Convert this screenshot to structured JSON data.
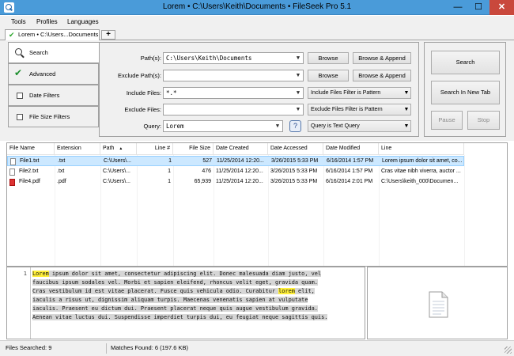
{
  "window": {
    "title": "Lorem • C:\\Users\\Keith\\Documents • FileSeek Pro 5.1",
    "minimize_glyph": "—",
    "maximize_glyph": "☐",
    "close_glyph": "✕"
  },
  "menu": [
    "Tools",
    "Profiles",
    "Languages"
  ],
  "tabs": {
    "active_label": "Lorem • C:\\Users...Documents",
    "add_glyph": "+"
  },
  "sidebar": [
    {
      "label": "Search",
      "icon": "search-icon",
      "active": true
    },
    {
      "label": "Advanced",
      "icon": "checked-checkbox-icon",
      "active": false
    },
    {
      "label": "Date Filters",
      "icon": "checkbox-icon",
      "active": false
    },
    {
      "label": "File Size Filters",
      "icon": "checkbox-icon",
      "active": false
    }
  ],
  "form": {
    "paths_label": "Path(s):",
    "paths_value": "C:\\Users\\Keith\\Documents",
    "exclude_paths_label": "Exclude Path(s):",
    "exclude_paths_value": "",
    "include_files_label": "Include Files:",
    "include_files_value": "*.*",
    "exclude_files_label": "Exclude Files:",
    "exclude_files_value": "",
    "query_label": "Query:",
    "query_value": "Lorem",
    "browse_label": "Browse",
    "browse_append_label": "Browse & Append",
    "include_filter_mode": "Include Files Filter is Pattern",
    "exclude_filter_mode": "Exclude Files Filter is Pattern",
    "query_mode": "Query is Text Query",
    "help_glyph": "?"
  },
  "actions": {
    "search": "Search",
    "search_new_tab": "Search In New Tab",
    "pause": "Pause",
    "stop": "Stop"
  },
  "results": {
    "columns": [
      "File Name",
      "Extension",
      "Path",
      "Line #",
      "File Size",
      "Date Created",
      "Date Accessed",
      "Date Modified",
      "Line"
    ],
    "sort_glyph": "▲",
    "rows": [
      {
        "name": "File1.txt",
        "ext": ".txt",
        "path": "C:\\Users\\...",
        "line": "1",
        "size": "527",
        "created": "11/25/2014 12:20...",
        "accessed": "3/26/2015 5:33 PM",
        "modified": "6/16/2014 1:57 PM",
        "text": "Lorem ipsum dolor sit amet, co...",
        "type": "txt",
        "selected": true
      },
      {
        "name": "File2.txt",
        "ext": ".txt",
        "path": "C:\\Users\\...",
        "line": "1",
        "size": "476",
        "created": "11/25/2014 12:20...",
        "accessed": "3/26/2015 5:33 PM",
        "modified": "6/16/2014 1:57 PM",
        "text": "Cras vitae nibh viverra, auctor ...",
        "type": "txt",
        "selected": false
      },
      {
        "name": "File4.pdf",
        "ext": ".pdf",
        "path": "C:\\Users\\...",
        "line": "1",
        "size": "65,939",
        "created": "11/25/2014 12:20...",
        "accessed": "3/26/2015 5:33 PM",
        "modified": "6/16/2014 2:01 PM",
        "text": "C:\\Users\\keith_000\\Documen...",
        "type": "pdf",
        "selected": false
      }
    ]
  },
  "preview": {
    "line_number": "1",
    "lines": [
      [
        {
          "t": "Lorem",
          "hl": true
        },
        {
          "t": " ipsum dolor sit amet, consectetur adipiscing elit. Donec malesuada diam justo, vel"
        }
      ],
      [
        {
          "t": "faucibus ipsum sodales vel. Morbi et sapien eleifend, rhoncus velit eget, gravida quam."
        }
      ],
      [
        {
          "t": "Cras vestibulum id est vitae placerat. Fusce quis vehicula odio. Curabitur "
        },
        {
          "t": "lorem",
          "hl": true
        },
        {
          "t": " elit,"
        }
      ],
      [
        {
          "t": "iaculis a risus ut, dignissim aliquam turpis. Maecenas venenatis sapien at vulputate"
        }
      ],
      [
        {
          "t": "iaculis. Praesent eu dictum dui. Praesent placerat neque quis augue vestibulum gravida."
        }
      ],
      [
        {
          "t": "Aenean vitae luctus dui. Suspendisse imperdiet turpis dui, eu feugiat neque sagittis quis."
        }
      ]
    ]
  },
  "status": {
    "files_searched": "Files Searched: 9",
    "matches_found": "Matches Found: 6 (197.6 KB)"
  },
  "colors": {
    "titlebar": "#4a9bd9",
    "close": "#c9483c",
    "selection": "#cce8ff",
    "highlight": "#ffef3a"
  }
}
